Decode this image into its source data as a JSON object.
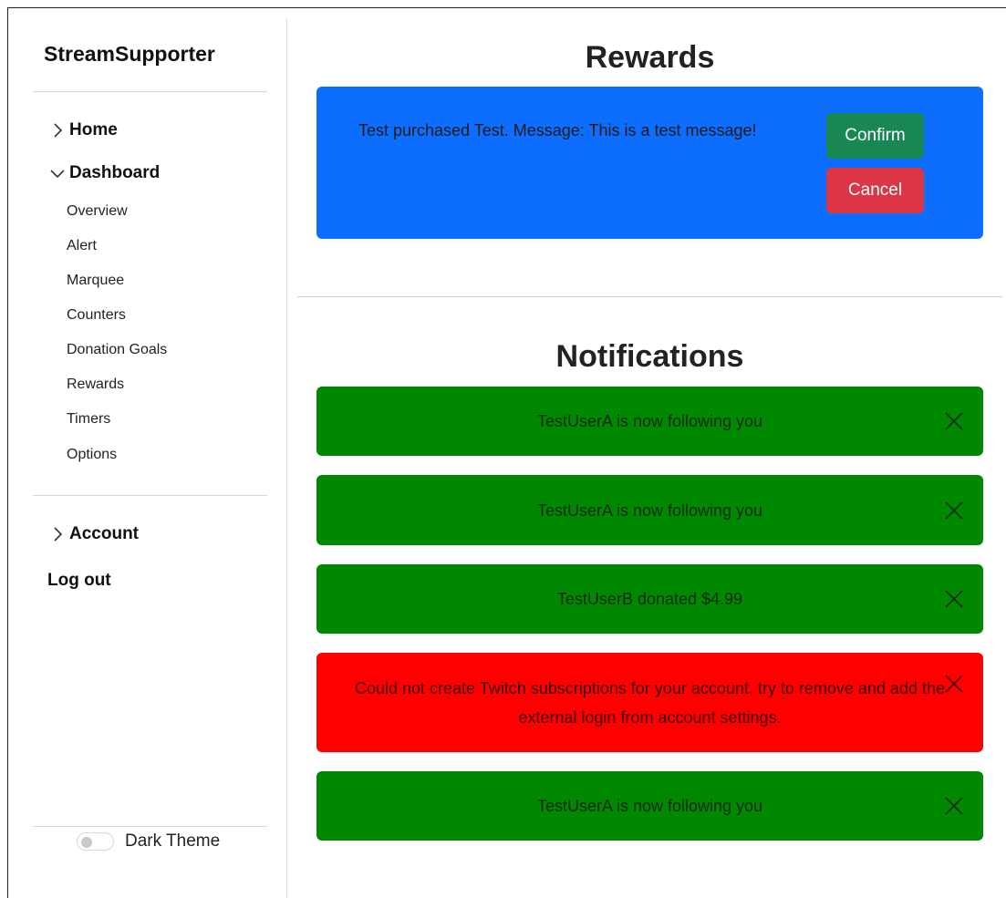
{
  "sidebar": {
    "brand": "StreamSupporter",
    "nav": {
      "home": "Home",
      "dashboard": "Dashboard",
      "account": "Account",
      "logout": "Log out"
    },
    "dashboard_items": [
      "Overview",
      "Alert",
      "Marquee",
      "Counters",
      "Donation Goals",
      "Rewards",
      "Timers",
      "Options"
    ],
    "theme_toggle": {
      "label": "Dark Theme",
      "enabled": false
    }
  },
  "rewards": {
    "title": "Rewards",
    "card": {
      "message": "Test purchased Test. Message: This is a test message!",
      "confirm_label": "Confirm",
      "cancel_label": "Cancel"
    }
  },
  "notifications": {
    "title": "Notifications",
    "items": [
      {
        "text": "TestUserA is now following you",
        "status": "success"
      },
      {
        "text": "TestUserA is now following you",
        "status": "success"
      },
      {
        "text": "TestUserB donated $4.99",
        "status": "success"
      },
      {
        "text": "Could not create Twitch subscriptions for your account, try to remove and add the external login from account settings.",
        "status": "error"
      },
      {
        "text": "TestUserA is now following you",
        "status": "success"
      }
    ]
  },
  "colors": {
    "reward_card": "#0d6efd",
    "confirm": "#198754",
    "cancel": "#dc3545",
    "notif_success": "#008800",
    "notif_error": "#ff0000"
  },
  "icons": {
    "collapsed": "chevron-right-icon",
    "expanded": "chevron-down-icon",
    "dismiss": "close-icon"
  }
}
